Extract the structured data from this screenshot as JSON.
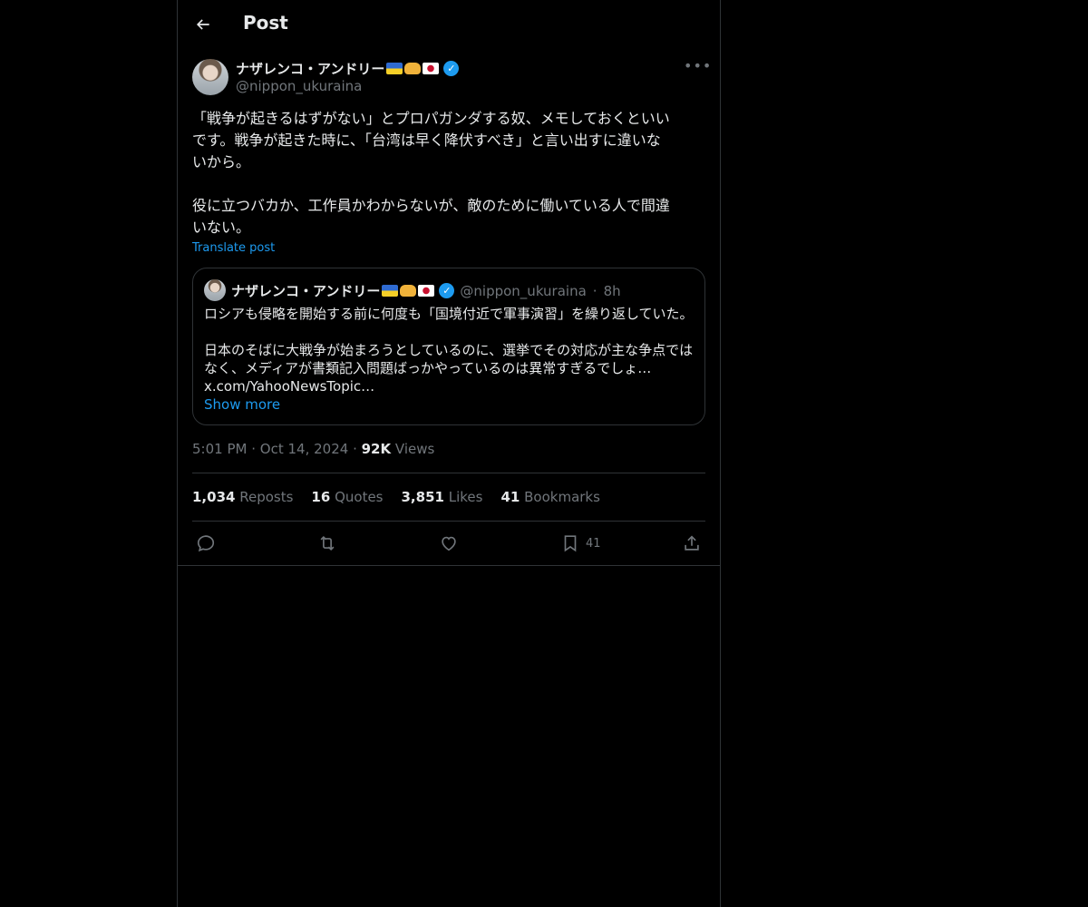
{
  "header": {
    "title": "Post"
  },
  "post": {
    "author_name": "ナザレンコ・アンドリー",
    "author_handle": "@nippon_ukuraina",
    "text": "「戦争が起きるはずがない」とプロパガンダする奴、メモしておくといい\nです。戦争が起きた時に、「台湾は早く降伏すべき」と言い出すに違いな\nいから。\n\n役に立つバカか、工作員かわからないが、敵のために働いている人で間違\nいない。",
    "translate_label": "Translate post",
    "time": "5:01 PM",
    "date": "Oct 14, 2024",
    "views_count": "92K",
    "views_label": "Views"
  },
  "quote": {
    "author_name": "ナザレンコ・アンドリー",
    "author_handle": "@nippon_ukuraina",
    "time": "8h",
    "text": "ロシアも侵略を開始する前に何度も「国境付近で軍事演習」を繰り返していた。\n\n日本のそばに大戦争が始まろうとしているのに、選挙でその対応が主な争点では\nなく、メディアが書類記入問題ばっかやっているのは異常すぎるでしょ…\nx.com/YahooNewsTopic…",
    "show_more": "Show more"
  },
  "stats": {
    "reposts_count": "1,034",
    "reposts_label": "Reposts",
    "quotes_count": "16",
    "quotes_label": "Quotes",
    "likes_count": "3,851",
    "likes_label": "Likes",
    "bookmarks_count": "41",
    "bookmarks_label": "Bookmarks"
  },
  "actions": {
    "bookmark_count": "41"
  },
  "icons": {
    "back": "arrow-left-icon",
    "more": "more-horizontal-icon",
    "verified": "verified-badge-icon",
    "reply": "reply-icon",
    "repost": "repost-icon",
    "like": "heart-icon",
    "bookmark": "bookmark-icon",
    "share": "share-icon"
  },
  "colors": {
    "background": "#000000",
    "text": "#e7e9ea",
    "secondary": "#71767b",
    "accent": "#1d9bf0",
    "border": "#2f3336"
  }
}
